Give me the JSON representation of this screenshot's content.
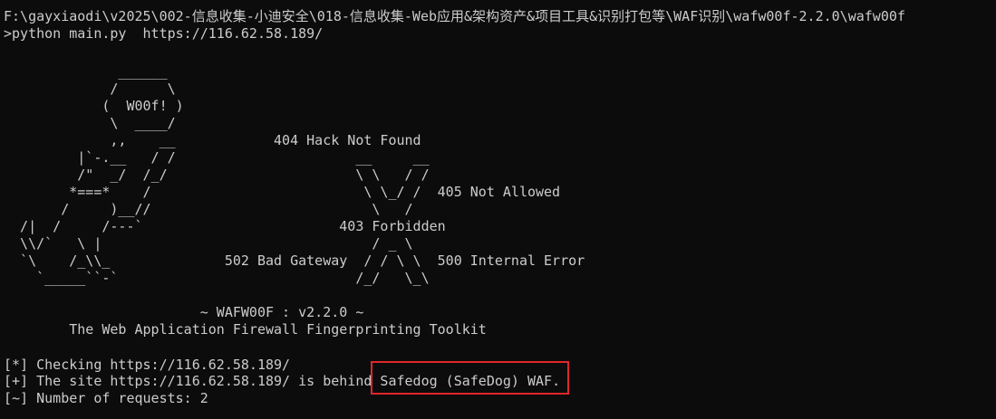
{
  "terminal": {
    "path_line": "F:\\gayxiaodi\\v2025\\002-信息收集-小迪安全\\018-信息收集-Web应用&架构资产&项目工具&识别打包等\\WAF识别\\wafw00f-2.2.0\\wafw00f",
    "command_line": ">python main.py  https://116.62.58.189/",
    "banner": [
      "              ______",
      "             /      \\",
      "            (  W00f! )",
      "             \\  ____/",
      "             ,,    __            404 Hack Not Found",
      "         |`-.__   / /                      __     __",
      "         /\"  _/  /_/                       \\ \\   / /",
      "        *===*    /                          \\ \\_/ /  405 Not Allowed",
      "       /     )__//                           \\   /",
      "  /|  /     /---`                        403 Forbidden",
      "  \\\\/`   \\ |                                 / _ \\",
      "  `\\    /_\\\\_              502 Bad Gateway  / / \\ \\  500 Internal Error",
      "    `_____``-`                             /_/   \\_\\"
    ],
    "version_line": "                        ~ WAFW00F : v2.2.0 ~",
    "tagline": "        The Web Application Firewall Fingerprinting Toolkit",
    "output": {
      "checking": "[*] Checking https://116.62.58.189/",
      "behind_prefix": "[+] The site https://116.62.58.189/ is behind ",
      "waf_result": "Safedog (SafeDog) WAF.",
      "requests": "[~] Number of requests: 2"
    },
    "colors": {
      "background": "#0c0c0c",
      "text": "#cccccc",
      "highlight_border": "#e0262a"
    }
  }
}
